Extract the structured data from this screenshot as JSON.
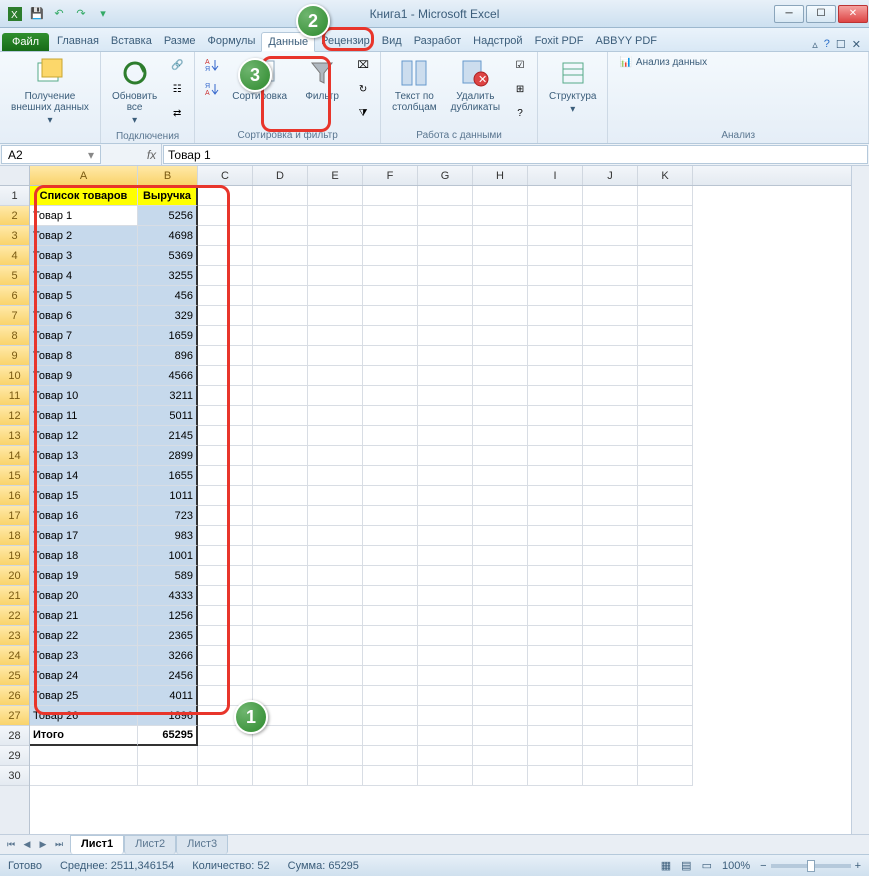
{
  "window": {
    "title": "Книга1  -  Microsoft Excel"
  },
  "qat": {
    "save": "💾",
    "undo": "↶",
    "redo": "↷"
  },
  "tabs": {
    "file": "Файл",
    "items": [
      "Главная",
      "Вставка",
      "Разме",
      "Формулы",
      "Данные",
      "Рецензир",
      "Вид",
      "Разработ",
      "Надстрой",
      "Foxit PDF",
      "ABBYY PDF"
    ],
    "active_index": 4
  },
  "ribbon": {
    "g1": {
      "btn": "Получение\nвнешних данных"
    },
    "g2": {
      "btn": "Обновить\nвсе",
      "label": "Подключения"
    },
    "g3": {
      "sort": "Сортировка",
      "filter": "Фильтр",
      "label": "Сортировка и фильтр"
    },
    "g4": {
      "text_cols": "Текст по\nстолбцам",
      "dedup": "Удалить\nдубликаты",
      "label": "Работа с данными"
    },
    "g5": {
      "btn": "Структура"
    },
    "g6": {
      "btn": "Анализ данных",
      "label": "Анализ"
    }
  },
  "namebox": "A2",
  "formula": "Товар 1",
  "columns": [
    "A",
    "B",
    "C",
    "D",
    "E",
    "F",
    "G",
    "H",
    "I",
    "J",
    "K"
  ],
  "headers": {
    "a": "Список товаров",
    "b": "Выручка"
  },
  "rows": [
    {
      "n": 2,
      "a": "Товар 1",
      "b": 5256
    },
    {
      "n": 3,
      "a": "Товар 2",
      "b": 4698
    },
    {
      "n": 4,
      "a": "Товар 3",
      "b": 5369
    },
    {
      "n": 5,
      "a": "Товар 4",
      "b": 3255
    },
    {
      "n": 6,
      "a": "Товар 5",
      "b": 456
    },
    {
      "n": 7,
      "a": "Товар 6",
      "b": 329
    },
    {
      "n": 8,
      "a": "Товар 7",
      "b": 1659
    },
    {
      "n": 9,
      "a": "Товар 8",
      "b": 896
    },
    {
      "n": 10,
      "a": "Товар 9",
      "b": 4566
    },
    {
      "n": 11,
      "a": "Товар 10",
      "b": 3211
    },
    {
      "n": 12,
      "a": "Товар 11",
      "b": 5011
    },
    {
      "n": 13,
      "a": "Товар 12",
      "b": 2145
    },
    {
      "n": 14,
      "a": "Товар 13",
      "b": 2899
    },
    {
      "n": 15,
      "a": "Товар 14",
      "b": 1655
    },
    {
      "n": 16,
      "a": "Товар 15",
      "b": 1011
    },
    {
      "n": 17,
      "a": "Товар 16",
      "b": 723
    },
    {
      "n": 18,
      "a": "Товар 17",
      "b": 983
    },
    {
      "n": 19,
      "a": "Товар 18",
      "b": 1001
    },
    {
      "n": 20,
      "a": "Товар 19",
      "b": 589
    },
    {
      "n": 21,
      "a": "Товар 20",
      "b": 4333
    },
    {
      "n": 22,
      "a": "Товар 21",
      "b": 1256
    },
    {
      "n": 23,
      "a": "Товар 22",
      "b": 2365
    },
    {
      "n": 24,
      "a": "Товар 23",
      "b": 3266
    },
    {
      "n": 25,
      "a": "Товар 24",
      "b": 2456
    },
    {
      "n": 26,
      "a": "Товар 25",
      "b": 4011
    },
    {
      "n": 27,
      "a": "Товар 26",
      "b": 1896
    }
  ],
  "total_row": {
    "n": 28,
    "a": "Итого",
    "b": 65295
  },
  "blank_rows": [
    29,
    30
  ],
  "sheets": {
    "active": "Лист1",
    "others": [
      "Лист2",
      "Лист3"
    ]
  },
  "status": {
    "ready": "Готово",
    "avg_label": "Среднее:",
    "avg": "2511,346154",
    "count_label": "Количество:",
    "count": "52",
    "sum_label": "Сумма:",
    "sum": "65295",
    "zoom": "100%"
  },
  "callouts": {
    "c1": "1",
    "c2": "2",
    "c3": "3"
  }
}
